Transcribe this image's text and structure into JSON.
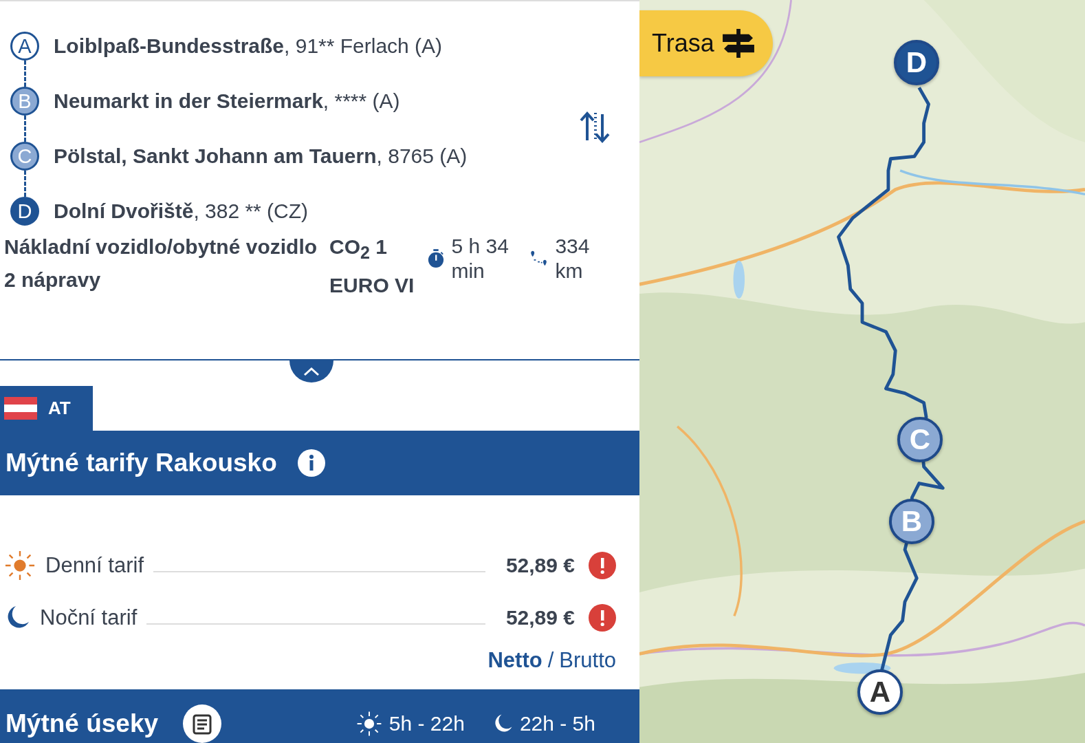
{
  "route": {
    "waypoints": [
      {
        "letter": "A",
        "kind": "start",
        "name": "Loiblpaß-Bundesstraße",
        "detail": ", 91** Ferlach (A)"
      },
      {
        "letter": "B",
        "kind": "via",
        "name": "Neumarkt in der Steiermark",
        "detail": ", **** (A)"
      },
      {
        "letter": "C",
        "kind": "via",
        "name": "Pölstal, Sankt Johann am Tauern",
        "detail": ", 8765 (A)"
      },
      {
        "letter": "D",
        "kind": "end",
        "name": "Dolní Dvořiště",
        "detail": ", 382 ** (CZ)"
      }
    ]
  },
  "vehicle": {
    "type": "Nákladní vozidlo/obytné vozidlo",
    "axles": "2 nápravy",
    "co2_class": "CO$_{2}$ 1",
    "emission": "EURO VI",
    "duration": "5 h 34 min",
    "distance": "334 km"
  },
  "country_tab": {
    "code": "AT"
  },
  "tariffs": {
    "title": "Mýtné tarify Rakousko",
    "items": [
      {
        "kind": "day",
        "label": "Denní tarif",
        "price": "52,89 €"
      },
      {
        "kind": "night",
        "label": "Noční tarif",
        "price": "52,89 €"
      }
    ],
    "price_modes": [
      {
        "label": "Netto",
        "selected": true
      },
      {
        "label": "Brutto",
        "selected": false
      }
    ],
    "separator": "/"
  },
  "sections": {
    "title": "Mýtné úseky",
    "day_hours": "5h - 22h",
    "night_hours": "22h - 5h"
  },
  "map": {
    "button": "Trasa",
    "pins": [
      {
        "letter": "D",
        "kind": "end"
      },
      {
        "letter": "C",
        "kind": "via"
      },
      {
        "letter": "B",
        "kind": "via"
      },
      {
        "letter": "A",
        "kind": "start"
      }
    ]
  }
}
